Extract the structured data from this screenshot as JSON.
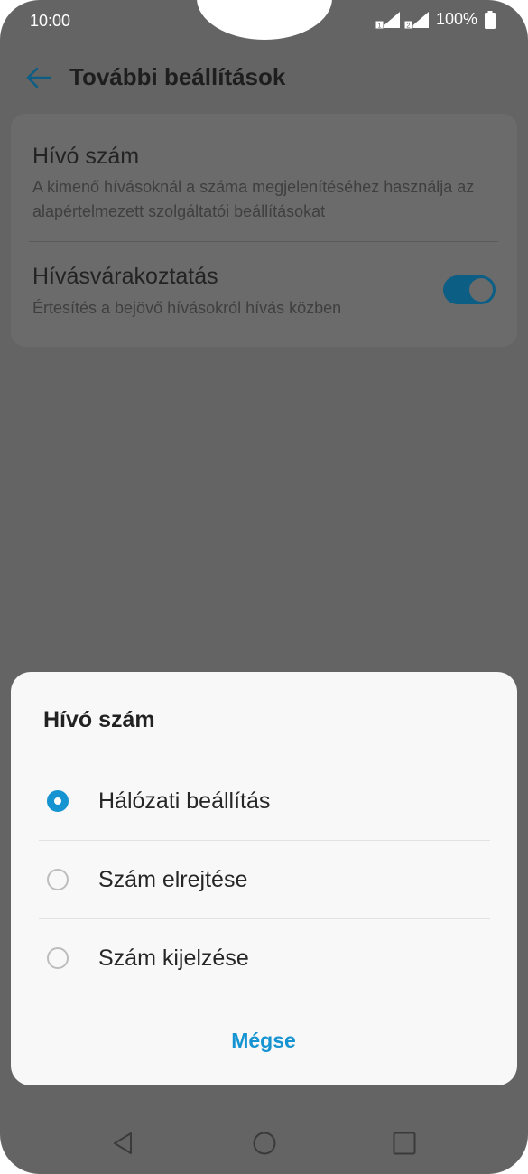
{
  "status_bar": {
    "time": "10:00",
    "battery": "100%",
    "icons": [
      "sim1-signal-icon",
      "sim2-signal-icon",
      "battery-icon"
    ]
  },
  "app_bar": {
    "title": "További beállítások",
    "back_icon": "arrow-left-icon"
  },
  "settings": [
    {
      "title": "Hívó szám",
      "subtitle": "A kimenő hívásoknál a száma megjelenítéséhez használja az alapértelmezett szolgáltatói beállításokat"
    },
    {
      "title": "Hívásvárakoztatás",
      "subtitle": "Értesítés a bejövő hívásokról hívás közben",
      "toggle": true
    }
  ],
  "dialog": {
    "title": "Hívó szám",
    "options": [
      {
        "label": "Hálózati beállítás",
        "selected": true
      },
      {
        "label": "Szám elrejtése",
        "selected": false
      },
      {
        "label": "Szám kijelzése",
        "selected": false
      }
    ],
    "cancel_label": "Mégse"
  },
  "nav_bar": {
    "icons": [
      "back-triangle-icon",
      "home-circle-icon",
      "recents-square-icon"
    ]
  },
  "colors": {
    "accent": "#1693d1",
    "toggle_on": "#0c5e85",
    "scrim": "#646464"
  }
}
